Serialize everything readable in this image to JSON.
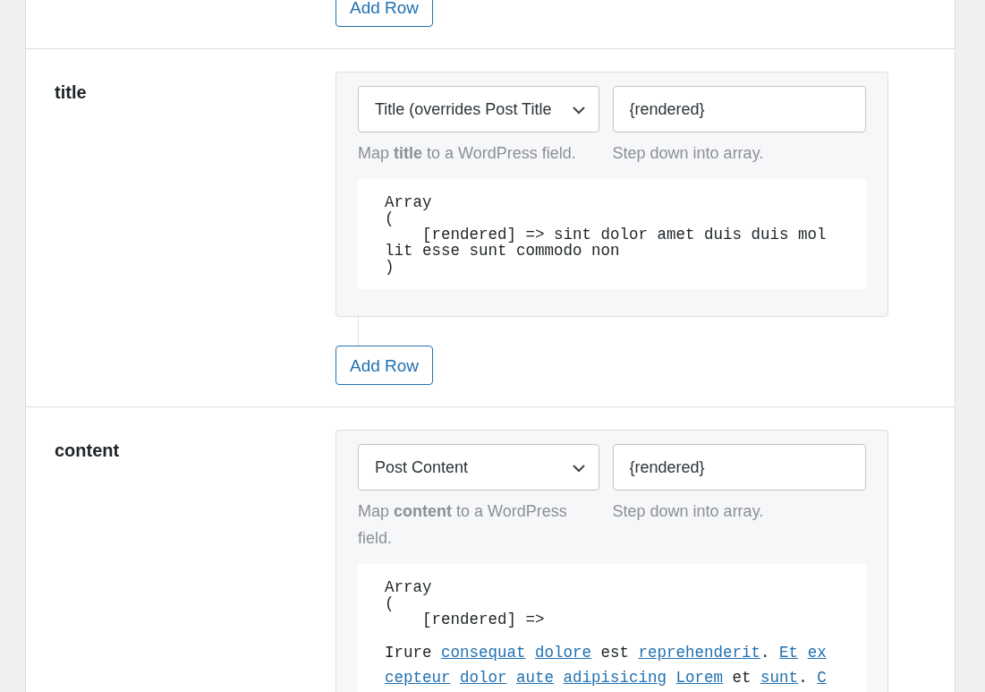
{
  "top_button": "Add Row",
  "fields": [
    {
      "name": "title",
      "mapping": {
        "value": "Title (overrides Post Title"
      },
      "path": {
        "value": "{rendered}"
      },
      "mapping_help": "Map **title** to a WordPress field.",
      "path_help": "Step down into array.",
      "preview": "Array\n(\n    [rendered] => sint dolor amet duis duis mol\nlit esse sunt commodo non\n)",
      "add_button": "Add Row"
    },
    {
      "name": "content",
      "mapping": {
        "value": "Post Content"
      },
      "path": {
        "value": "{rendered}"
      },
      "mapping_help": "Map **content** to a WordPress field.",
      "path_help": "Step down into array.",
      "preview": "Array\n(\n    [rendered] =>",
      "preview_lines": [
        [
          {
            "text": "Irure",
            "kind": "text"
          },
          {
            "text": "consequat",
            "kind": "link"
          },
          {
            "text": "dolore",
            "kind": "link"
          },
          {
            "text": "est",
            "kind": "text"
          },
          {
            "text": "reprehenderit",
            "kind": "link"
          },
          {
            "text": ".",
            "kind": "punct"
          },
          {
            "text": "Et",
            "kind": "link"
          },
          {
            "text": "ex",
            "kind": "link"
          }
        ],
        [
          {
            "text": "cepteur",
            "kind": "link"
          },
          {
            "text": "dolor",
            "kind": "link"
          },
          {
            "text": "aute",
            "kind": "link"
          },
          {
            "text": "adipisicing",
            "kind": "link"
          },
          {
            "text": "Lorem",
            "kind": "link"
          },
          {
            "text": "et",
            "kind": "text"
          },
          {
            "text": "sunt",
            "kind": "link"
          },
          {
            "text": ".",
            "kind": "punct"
          },
          {
            "text": "C",
            "kind": "link"
          }
        ]
      ]
    }
  ]
}
